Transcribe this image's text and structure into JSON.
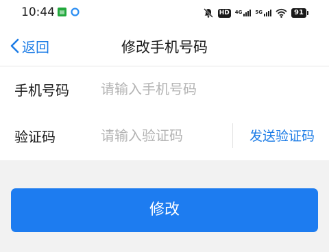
{
  "status_bar": {
    "time": "10:44",
    "app_icon_label": "",
    "hd_label": "HD",
    "net1_label": "4G",
    "net2_label": "5G",
    "battery": "91"
  },
  "nav": {
    "back_label": "返回",
    "title": "修改手机号码"
  },
  "form": {
    "phone": {
      "label": "手机号码",
      "placeholder": "请输入手机号码",
      "value": ""
    },
    "code": {
      "label": "验证码",
      "placeholder": "请输入验证码",
      "value": "",
      "send_label": "发送验证码"
    }
  },
  "submit_label": "修改",
  "colors": {
    "accent": "#1c7ce6",
    "button": "#1d7cf0",
    "background": "#f2f2f2"
  }
}
